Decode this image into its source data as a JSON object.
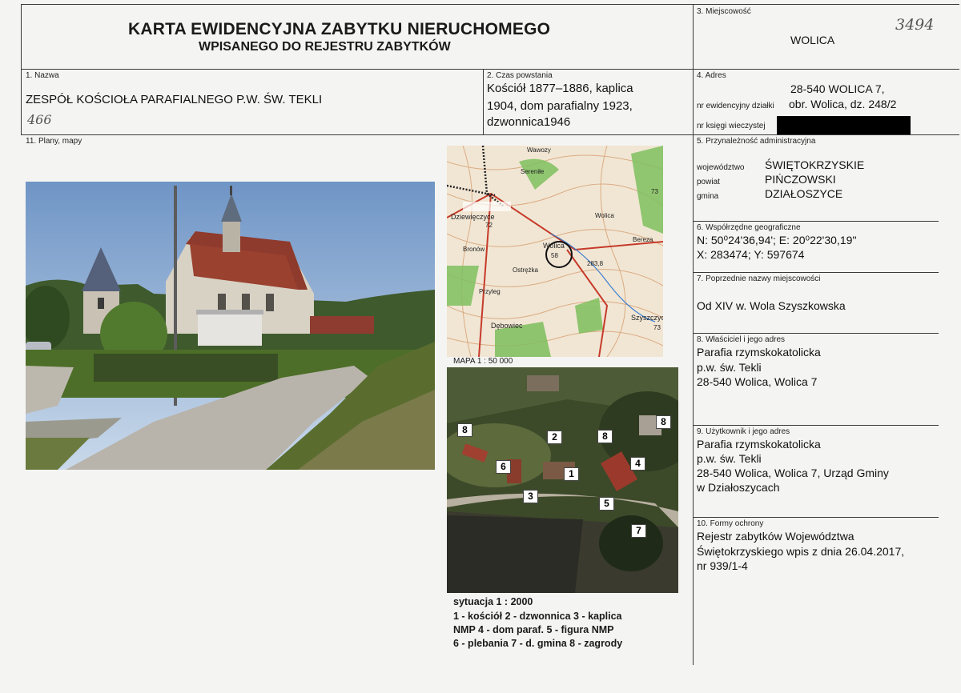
{
  "header": {
    "title_line1": "KARTA EWIDENCYJNA ZABYTKU NIERUCHOMEGO",
    "title_line2": "WPISANEGO DO REJESTRU ZABYTKÓW"
  },
  "field3": {
    "label": "3. Miejscowość",
    "value": "WOLICA",
    "handwritten": "3494"
  },
  "field1": {
    "label": "1. Nazwa",
    "value": "ZESPÓŁ KOŚCIOŁA PARAFIALNEGO P.W. ŚW. TEKLI",
    "handwritten": "466"
  },
  "field2": {
    "label": "2. Czas powstania",
    "lines": [
      "Kościół  1877–1886,  kaplica",
      "1904, dom parafialny 1923,",
      "dzwonnica1946"
    ]
  },
  "field4": {
    "label": "4. Adres",
    "address": "28-540 WOLICA 7,",
    "plot_label": "nr ewidencyjny działki",
    "plot_value": "obr. Wolica, dz. 248/2",
    "book_label": "nr księgi wieczystej"
  },
  "field11": {
    "label": "11. Plany, mapy"
  },
  "field5": {
    "label": "5. Przynależność administracyjna",
    "rows": [
      {
        "key": "województwo",
        "value": "ŚWIĘTOKRZYSKIE"
      },
      {
        "key": "powiat",
        "value": "PIŃCZOWSKI"
      },
      {
        "key": "gmina",
        "value": "DZIAŁOSZYCE"
      }
    ]
  },
  "field6": {
    "label": "6. Współrzędne geograficzne",
    "line1": "N: 50⁰24'36,94'; E: 20⁰22'30,19''",
    "line2": "X: 283474; Y: 597674"
  },
  "field7": {
    "label": "7. Poprzednie nazwy miejscowości",
    "value": "Od XIV w. Wola Szyszkowska"
  },
  "field8": {
    "label": "8. Właściciel i jego adres",
    "lines": [
      "Parafia rzymskokatolicka",
      "p.w. św. Tekli",
      "28-540 Wolica, Wolica 7"
    ]
  },
  "field9": {
    "label": "9. Użytkownik i jego adres",
    "lines": [
      "Parafia rzymskokatolicka",
      "p.w. św. Tekli",
      "28-540 Wolica, Wolica 7, Urząd Gminy",
      "w Działoszycach"
    ]
  },
  "field10": {
    "label": "10. Formy ochrony",
    "lines": [
      "Rejestr zabytków Województwa",
      "Świętokrzyskiego  wpis z dnia 26.04.2017,",
      "nr 939/1-4"
    ]
  },
  "map": {
    "caption": "MAPA 1 : 50 000",
    "places": [
      "Wawozy",
      "Sereniłe",
      "Dziewięczyce",
      "Wolica",
      "Bereza",
      "Wolica",
      "Bronów",
      "Ostrężka",
      "Przyleg",
      "Szyszczyce",
      "Dębowiec",
      "283,8",
      "73",
      "72",
      "58",
      "73"
    ]
  },
  "aerial": {
    "markers": [
      "8",
      "2",
      "8",
      "8",
      "6",
      "1",
      "4",
      "3",
      "5",
      "7"
    ]
  },
  "legend": {
    "lines": [
      "sytuacja 1 : 2000",
      "1 - kościół  2 - dzwonnica  3 - kaplica",
      "NMP  4 - dom paraf.  5 - figura NMP",
      "6 - plebania  7 - d. gmina  8 - zagrody"
    ]
  }
}
